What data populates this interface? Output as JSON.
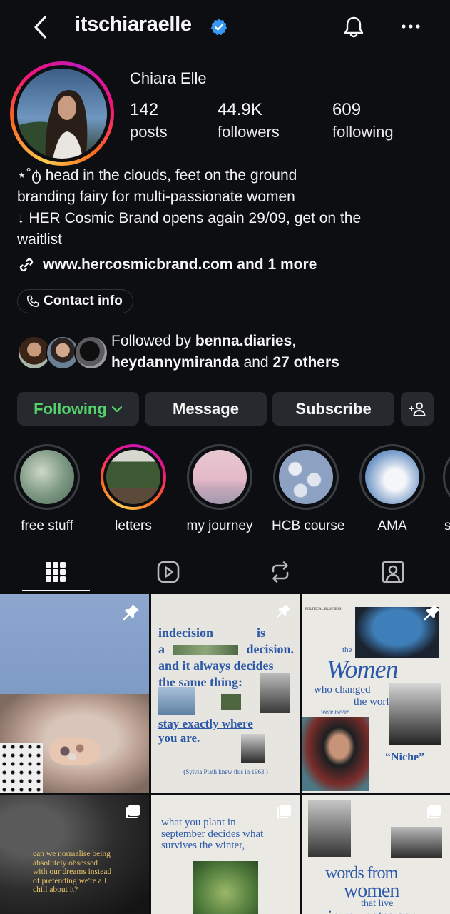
{
  "header": {
    "username": "itschiaraelle",
    "icons": [
      "chevron-left-icon",
      "verified-badge-icon",
      "bell-icon",
      "more-icon"
    ]
  },
  "profile": {
    "display_name": "Chiara Elle",
    "stats": [
      {
        "value": "142",
        "label": "posts"
      },
      {
        "value": "44.9K",
        "label": "followers"
      },
      {
        "value": "609",
        "label": "following"
      }
    ],
    "bio_lines": [
      "⋆˚ტ head in the clouds, feet on the ground",
      "branding fairy for multi-passionate women",
      "↓ HER Cosmic Brand opens again 29/09, get on the",
      "waitlist"
    ],
    "link": "www.hercosmicbrand.com and 1 more",
    "contact_label": "Contact info",
    "followed_by": {
      "prefix": "Followed by ",
      "user1": "benna.diaries",
      "comma": ",",
      "user2": "heydannymiranda",
      "and": " and ",
      "others": "27 others"
    }
  },
  "actions": {
    "following": "Following",
    "message": "Message",
    "subscribe": "Subscribe"
  },
  "highlights": [
    {
      "label": "free stuff"
    },
    {
      "label": "letters"
    },
    {
      "label": "my journey"
    },
    {
      "label": "HCB course"
    },
    {
      "label": "AMA"
    },
    {
      "label": "se"
    }
  ],
  "tabs": [
    "grid-icon",
    "reels-icon",
    "reposts-icon",
    "tagged-icon"
  ],
  "posts": {
    "p2": {
      "l1a": "indecision",
      "l1b": "is",
      "l2a": "a",
      "l2b": "decision.",
      "l3": "and it always decides",
      "l4": "the same thing:",
      "l5": "stay exactly where",
      "l6": "you are.",
      "caption": "(Sylvia Plath knew this in 1963.)"
    },
    "p3": {
      "header": "POLITICAL BUSINESS",
      "the": "the",
      "women": "Women",
      "l2": "who changed",
      "l3": "the world",
      "l4": "were never",
      "niche": "“Niche”"
    },
    "p4": {
      "l1": "can we normalise being",
      "l2": "absolutely obsessed",
      "l3": "with our dreams instead",
      "l4": "of pretending we're all",
      "l5": "chill about it?"
    },
    "p5": {
      "l1": "what you plant in",
      "l2": "september decides what",
      "l3": "survives the winter,"
    },
    "p6": {
      "l1": "words from",
      "l2": "women",
      "l3": "that live",
      "l4": "in my notes app"
    }
  }
}
